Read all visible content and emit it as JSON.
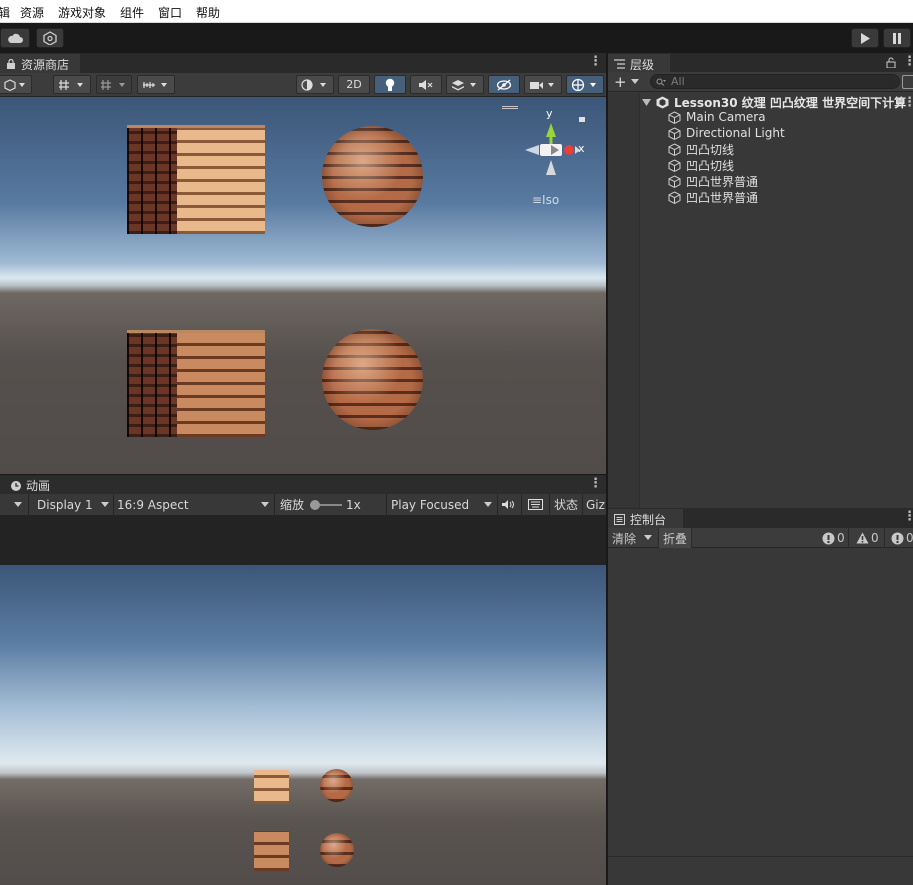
{
  "menubar": {
    "items": [
      "辑",
      "资源",
      "游戏对象",
      "组件",
      "窗口",
      "帮助"
    ]
  },
  "toolbar": {
    "cloud_icon": "cloud-icon",
    "collab_icon": "collab-icon",
    "play_icon": "play-icon",
    "pause_icon": "pause-icon"
  },
  "scene_panel": {
    "tab_label": "资源商店",
    "toggle_2d": "2D",
    "iso_label": "≡Iso",
    "gizmo": {
      "x": "x",
      "y": "y"
    }
  },
  "game_panel": {
    "tab_label": "动画",
    "display": "Display 1",
    "aspect": "16:9 Aspect",
    "scale_label": "缩放",
    "scale_value": "1x",
    "play_mode": "Play Focused",
    "stats": "状态",
    "gizmos": "Giz"
  },
  "hierarchy": {
    "tab_label": "层级",
    "search_placeholder": "All",
    "scene_name": "Lesson30 纹理 凹凸纹理 世界空间下计算",
    "items": [
      "Main Camera",
      "Directional Light",
      "凹凸切线",
      "凹凸切线",
      "凹凸世界普通",
      "凹凸世界普通"
    ]
  },
  "console": {
    "tab_label": "控制台",
    "clear": "清除",
    "collapse": "折叠",
    "log_count": "0",
    "warn_count": "0",
    "error_count": "0"
  },
  "colors": {
    "accent": "#46607c",
    "panel": "#383838",
    "background": "#191919"
  }
}
